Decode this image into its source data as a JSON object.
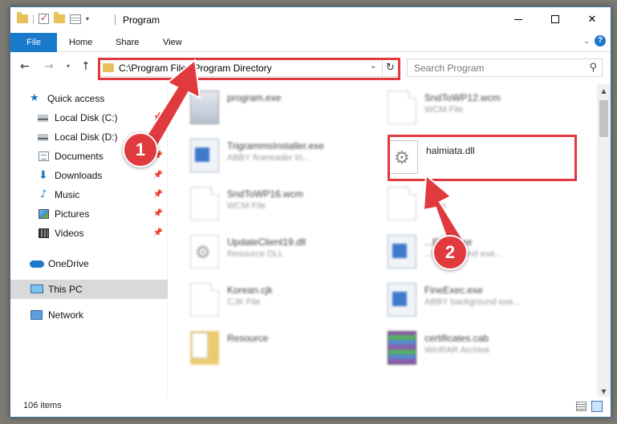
{
  "window": {
    "title": "Program",
    "controls": {
      "minimize": "—",
      "maximize": "☐",
      "close": "✕"
    }
  },
  "ribbon": {
    "tabs": [
      {
        "label": "File"
      },
      {
        "label": "Home"
      },
      {
        "label": "Share"
      },
      {
        "label": "View"
      }
    ],
    "help": "?"
  },
  "nav": {
    "back": "←",
    "forward": "→",
    "up": "↑",
    "address": "C:\\Program Files\\Program Directory",
    "search_placeholder": "Search Program"
  },
  "sidebar": {
    "items": [
      {
        "label": "Quick access",
        "icon": "star-icon",
        "pinned": false
      },
      {
        "label": "Local Disk (C:)",
        "icon": "disk-icon",
        "pinned": true
      },
      {
        "label": "Local Disk (D:)",
        "icon": "disk-icon",
        "pinned": true
      },
      {
        "label": "Documents",
        "icon": "documents-icon",
        "pinned": true
      },
      {
        "label": "Downloads",
        "icon": "download-icon",
        "pinned": true
      },
      {
        "label": "Music",
        "icon": "music-icon",
        "pinned": true
      },
      {
        "label": "Pictures",
        "icon": "pictures-icon",
        "pinned": true
      },
      {
        "label": "Videos",
        "icon": "videos-icon",
        "pinned": true
      },
      {
        "label": "OneDrive",
        "icon": "cloud-icon",
        "pinned": false
      },
      {
        "label": "This PC",
        "icon": "pc-icon",
        "pinned": false,
        "selected": true
      },
      {
        "label": "Network",
        "icon": "network-icon",
        "pinned": false
      }
    ]
  },
  "files": {
    "left": [
      {
        "name": "program.exe",
        "type": "",
        "icon": "setup-icon"
      },
      {
        "name": "TrigrammsInstaller.exe",
        "type": "ABBY finereader tri...",
        "icon": "exe-icon"
      },
      {
        "name": "SndToWP16.wcm",
        "type": "WCM File",
        "icon": "document-icon"
      },
      {
        "name": "UpdateClient19.dll",
        "type": "Resource DLL",
        "icon": "gear-file-icon"
      },
      {
        "name": "Korean.cjk",
        "type": "CJK File",
        "icon": "document-icon"
      },
      {
        "name": "Resource",
        "type": "",
        "icon": "folder-icon"
      }
    ],
    "right": [
      {
        "name": "SndToWP12.wcm",
        "type": "WCM File",
        "icon": "document-icon"
      },
      {
        "name": "halmiata.dll",
        "type": "",
        "icon": "gear-file-icon"
      },
      {
        "name": "...cjk",
        "type": "...File",
        "icon": "document-icon"
      },
      {
        "name": "...Exec.exe",
        "type": "...background exe...",
        "icon": "exe-icon"
      },
      {
        "name": "FineExec.exe",
        "type": "ABBY background exe...",
        "icon": "exe-icon"
      },
      {
        "name": "certificates.cab",
        "type": "WinRAR Archive",
        "icon": "archive-icon"
      }
    ]
  },
  "callouts": {
    "first": "1",
    "second": "2"
  },
  "status": {
    "items": "106 items"
  },
  "colors": {
    "accent": "#1979ca",
    "highlight": "#e03a3e"
  }
}
